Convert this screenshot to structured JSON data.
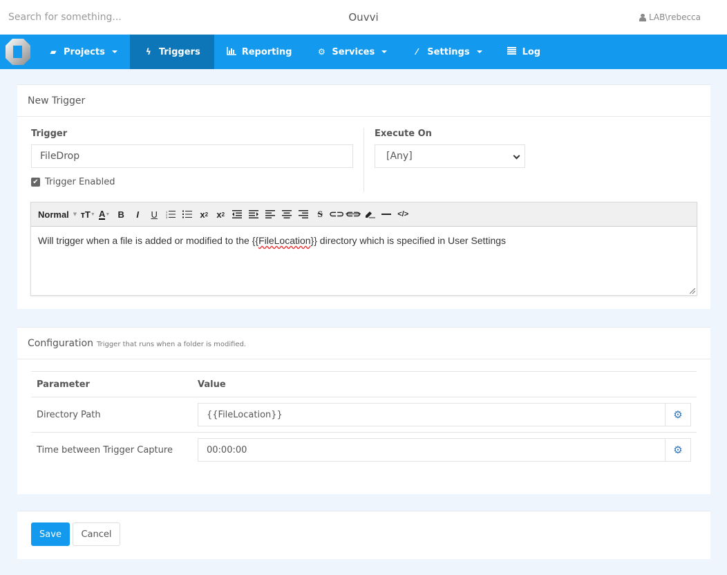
{
  "topbar": {
    "search_placeholder": "Search for something...",
    "app_title": "Ouvvi",
    "user": "LAB\\rebecca"
  },
  "nav": {
    "items": [
      {
        "label": "Projects",
        "icon": "book-icon",
        "dropdown": true,
        "active": false
      },
      {
        "label": "Triggers",
        "icon": "bolt-icon",
        "dropdown": false,
        "active": true
      },
      {
        "label": "Reporting",
        "icon": "bar-chart-icon",
        "dropdown": false,
        "active": false
      },
      {
        "label": "Services",
        "icon": "cogs-icon",
        "dropdown": true,
        "active": false
      },
      {
        "label": "Settings",
        "icon": "magic-wand-icon",
        "dropdown": true,
        "active": false
      },
      {
        "label": "Log",
        "icon": "list-icon",
        "dropdown": false,
        "active": false
      }
    ]
  },
  "new_trigger": {
    "title": "New Trigger",
    "trigger_label": "Trigger",
    "trigger_value": "FileDrop",
    "enabled_label": "Trigger Enabled",
    "enabled": true,
    "execute_on_label": "Execute On",
    "execute_on_value": "[Any]",
    "editor": {
      "style_select": "Normal",
      "description_before": "Will trigger when a file is added or modified to the {{",
      "description_misspelled": "FileLocation",
      "description_after": "}} directory which is specified in User Settings"
    }
  },
  "configuration": {
    "title": "Configuration",
    "subtitle": "Trigger that runs when a folder is modified.",
    "headers": {
      "parameter": "Parameter",
      "value": "Value"
    },
    "rows": [
      {
        "parameter": "Directory Path",
        "value": "{{FileLocation}}"
      },
      {
        "parameter": "Time between Trigger Capture",
        "value": "00:00:00"
      }
    ]
  },
  "actions": {
    "save": "Save",
    "cancel": "Cancel"
  },
  "colors": {
    "brand": "#1399ed",
    "active_nav": "#0d76b8",
    "page_bg": "#eef5fc",
    "gear": "#2f76b8"
  }
}
